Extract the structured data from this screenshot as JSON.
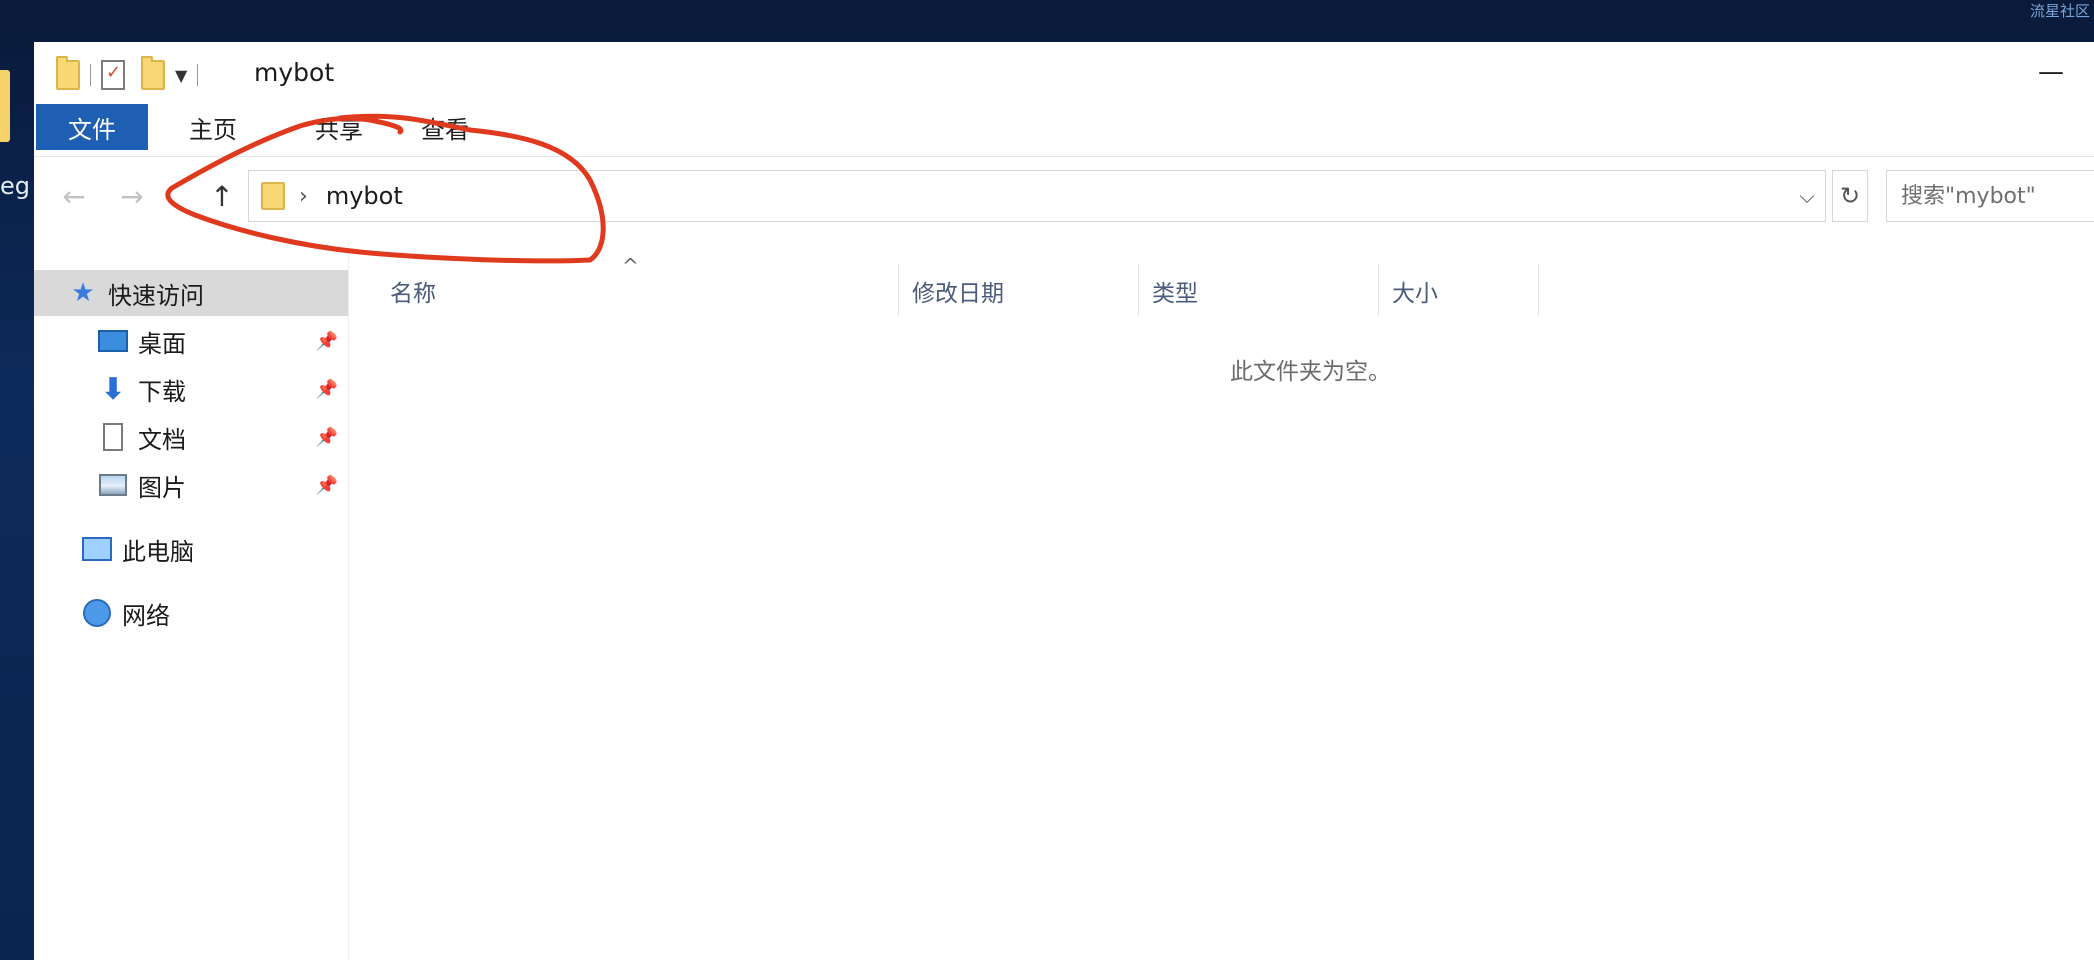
{
  "desktop": {
    "corner_text": "流星社区",
    "icon_label": "eg"
  },
  "window": {
    "title": "mybot",
    "minimize_symbol": "—",
    "ribbon_tabs": [
      {
        "label": "文件"
      },
      {
        "label": "主页"
      },
      {
        "label": "共享"
      },
      {
        "label": "查看"
      }
    ],
    "address": {
      "path": "mybot",
      "separator": "›"
    },
    "search": {
      "placeholder": "搜索\"mybot\""
    },
    "nav_symbols": {
      "back": "←",
      "forward": "→",
      "up": "↑",
      "dropdown": "⌵",
      "refresh": "↻",
      "sort": "^"
    },
    "sidebar": {
      "quick_access": "快速访问",
      "items": [
        {
          "label": "桌面",
          "icon": "desktop-icon"
        },
        {
          "label": "下载",
          "icon": "download-icon"
        },
        {
          "label": "文档",
          "icon": "document-icon"
        },
        {
          "label": "图片",
          "icon": "picture-icon"
        }
      ],
      "this_pc": "此电脑",
      "network": "网络"
    },
    "columns": [
      "名称",
      "修改日期",
      "类型",
      "大小"
    ],
    "empty_message": "此文件夹为空。"
  },
  "colors": {
    "file_tab": "#1f5fb3",
    "annotation": "#e03a1e",
    "selected_nav": "#d9d9d9"
  }
}
